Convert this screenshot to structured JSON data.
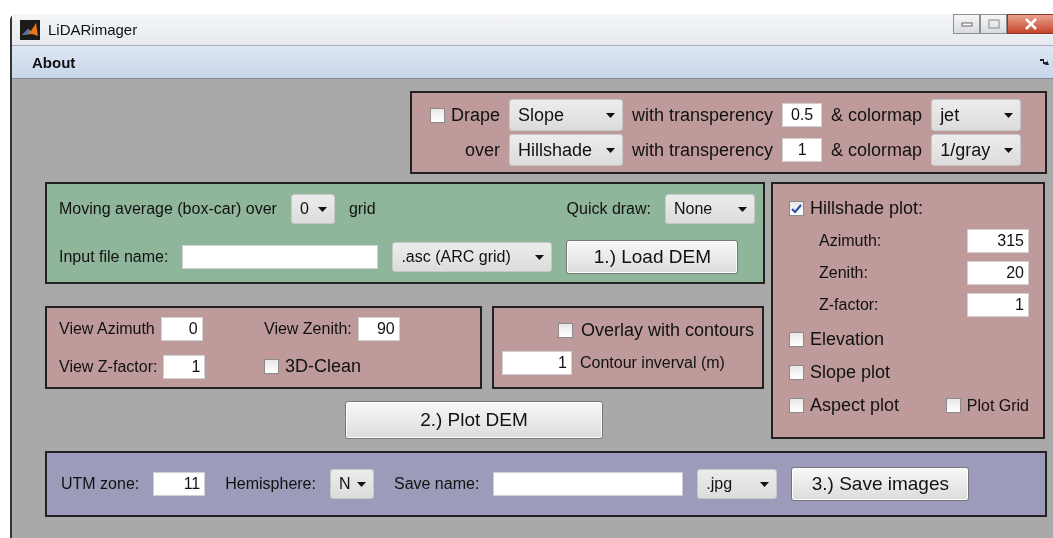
{
  "window": {
    "title": "LiDARimager"
  },
  "menu": [
    {
      "label": "About"
    }
  ],
  "drape": {
    "checked": false,
    "label": "Drape",
    "layer": "Slope",
    "transparency_label": "with transperency",
    "transparency": "0.5",
    "colormap_label": "& colormap",
    "colormap": "jet"
  },
  "over": {
    "label": "over",
    "layer": "Hillshade",
    "transparency_label": "with transperency",
    "transparency": "1",
    "colormap_label": "& colormap",
    "colormap": "1/gray"
  },
  "load": {
    "average_label": "Moving average (box-car) over",
    "average": "0",
    "grid_label": "grid",
    "quick_label": "Quick draw:",
    "quick": "None",
    "file_label": "Input file name:",
    "format": ".asc (ARC grid)",
    "button": "1.) Load DEM"
  },
  "view": {
    "azimuth_label": "View Azimuth",
    "azimuth": "0",
    "zenith_label": "View Zenith:",
    "zenith": "90",
    "zfactor_label": "View Z-factor:",
    "zfactor": "1",
    "clean_label": "3D-Clean",
    "clean_checked": false
  },
  "contours": {
    "overlay_label": "Overlay with contours",
    "overlay_checked": false,
    "interval": "1",
    "interval_label": "Contour inverval (m)"
  },
  "plot_button": "2.) Plot DEM",
  "hillshade": {
    "label": "Hillshade plot:",
    "checked": true,
    "params": [
      {
        "label": "Azimuth:",
        "value": "315"
      },
      {
        "label": "Zenith:",
        "value": "20"
      },
      {
        "label": "Z-factor:",
        "value": "1"
      }
    ],
    "options": [
      {
        "label": "Elevation",
        "checked": false
      },
      {
        "label": "Slope plot",
        "checked": false
      },
      {
        "label": "Aspect plot",
        "checked": false
      }
    ],
    "grid": {
      "label": "Plot Grid",
      "checked": false
    }
  },
  "save": {
    "utm_label": "UTM zone:",
    "utm": "11",
    "hemisphere_label": "Hemisphere:",
    "hemisphere": "N",
    "name_label": "Save name:",
    "format": ".jpg",
    "button": "3.) Save images"
  }
}
